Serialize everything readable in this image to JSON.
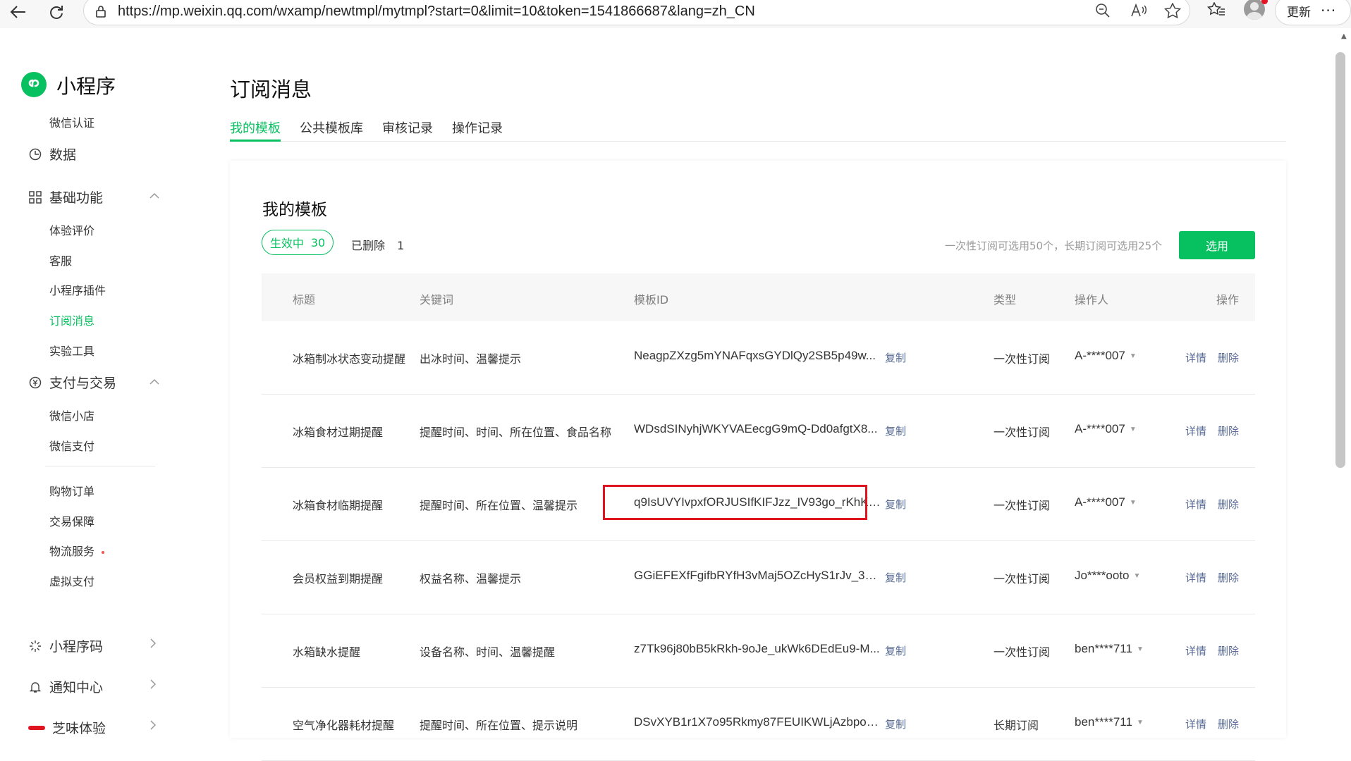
{
  "browser": {
    "url": "https://mp.weixin.qq.com/wxamp/newtmpl/mytmpl?start=0&limit=10&token=1541866687&lang=zh_CN",
    "update_label": "更新",
    "more_label": "···"
  },
  "sidebar": {
    "app_name": "小程序",
    "items": {
      "wechat_auth": "微信认证",
      "data": "数据",
      "basic": "基础功能",
      "experience": "体验评价",
      "service": "客服",
      "plugins": "小程序插件",
      "subscribe": "订阅消息",
      "lab": "实验工具",
      "payment": "支付与交易",
      "shop": "微信小店",
      "wxpay": "微信支付",
      "orders": "购物订单",
      "protect": "交易保障",
      "logistics": "物流服务",
      "virtual_pay": "虚拟支付",
      "qrcode": "小程序码",
      "notify": "通知中心",
      "zhiwei": "芝味体验"
    }
  },
  "main": {
    "title": "订阅消息",
    "tabs": [
      "我的模板",
      "公共模板库",
      "审核记录",
      "操作记录"
    ],
    "card_title": "我的模板",
    "active_filter": {
      "label": "生效中",
      "count": "30"
    },
    "deleted_filter": {
      "label": "已删除",
      "count": "1"
    },
    "quota_note": "一次性订阅可选用50个，长期订阅可选用25个",
    "select_button": "选用",
    "columns": [
      "标题",
      "关键词",
      "模板ID",
      "类型",
      "操作人",
      "操作"
    ],
    "copy_label": "复制",
    "detail_label": "详情",
    "delete_label": "删除",
    "rows": [
      {
        "title": "冰箱制冰状态变动提醒",
        "keywords": "出冰时间、温馨提示",
        "template_id": "NeagpZXzg5mYNAFqxsGYDlQy2SB5p49w...",
        "type": "一次性订阅",
        "operator": "A-****007"
      },
      {
        "title": "冰箱食材过期提醒",
        "keywords": "提醒时间、时间、所在位置、食品名称",
        "template_id": "WDsdSINyhjWKYVAEecgG9mQ-Dd0afgtX8...",
        "type": "一次性订阅",
        "operator": "A-****007"
      },
      {
        "title": "冰箱食材临期提醒",
        "keywords": "提醒时间、所在位置、温馨提示",
        "template_id": "q9IsUVYIvpxfORJUSIfKIFJzz_IV93go_rKhKC...",
        "type": "一次性订阅",
        "operator": "A-****007"
      },
      {
        "title": "会员权益到期提醒",
        "keywords": "权益名称、温馨提示",
        "template_id": "GGiEFEXfFgifbRYfH3vMaj5OZcHyS1rJv_378...",
        "type": "一次性订阅",
        "operator": "Jo****ooto"
      },
      {
        "title": "水箱缺水提醒",
        "keywords": "设备名称、时间、温馨提醒",
        "template_id": "z7Tk96j80bB5kRkh-9oJe_ukWk6DEdEu9-M...",
        "type": "一次性订阅",
        "operator": "ben****711"
      },
      {
        "title": "空气净化器耗材提醒",
        "keywords": "提醒时间、所在位置、提示说明",
        "template_id": "DSvXYB1r1X7o95Rkmy87FEUIKWLjAzbpoil...",
        "type": "长期订阅",
        "operator": "ben****711"
      }
    ]
  },
  "colors": {
    "accent": "#07c160",
    "link": "#576b95",
    "highlight": "#e0141e"
  }
}
